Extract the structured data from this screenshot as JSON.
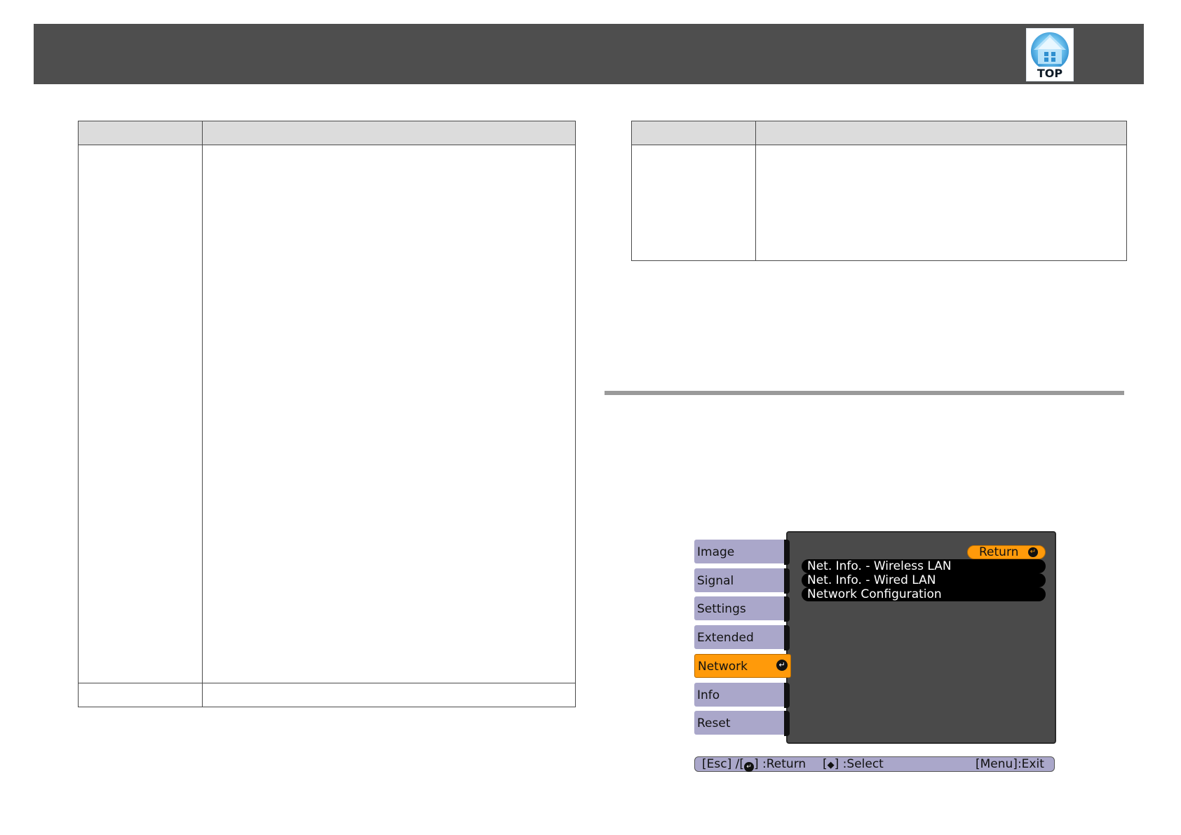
{
  "header": {
    "top_icon_label": "TOP"
  },
  "projector_menu": {
    "tabs": [
      {
        "label": "Image",
        "active": false
      },
      {
        "label": "Signal",
        "active": false
      },
      {
        "label": "Settings",
        "active": false
      },
      {
        "label": "Extended",
        "active": false
      },
      {
        "label": "Network",
        "active": true
      },
      {
        "label": "Info",
        "active": false
      },
      {
        "label": "Reset",
        "active": false
      }
    ],
    "return_label": "Return",
    "items": [
      "Net. Info. - Wireless LAN",
      "Net. Info. - Wired LAN",
      "Network Configuration"
    ],
    "status": {
      "esc": "[Esc] /[",
      "return": "] :Return",
      "select_open": "[",
      "select": "] :Select",
      "exit": "[Menu]:Exit"
    }
  },
  "colors": {
    "header_bar": "#4e4e4e",
    "table_header": "#dcdcdc",
    "menu_tab": "#aaa7ca",
    "menu_active": "#ff9a0a",
    "menu_panel": "#4a4a4a"
  },
  "icons": {
    "top": "home-top-icon",
    "enter": "enter-icon",
    "up_down": "up-down-arrow-icon"
  }
}
